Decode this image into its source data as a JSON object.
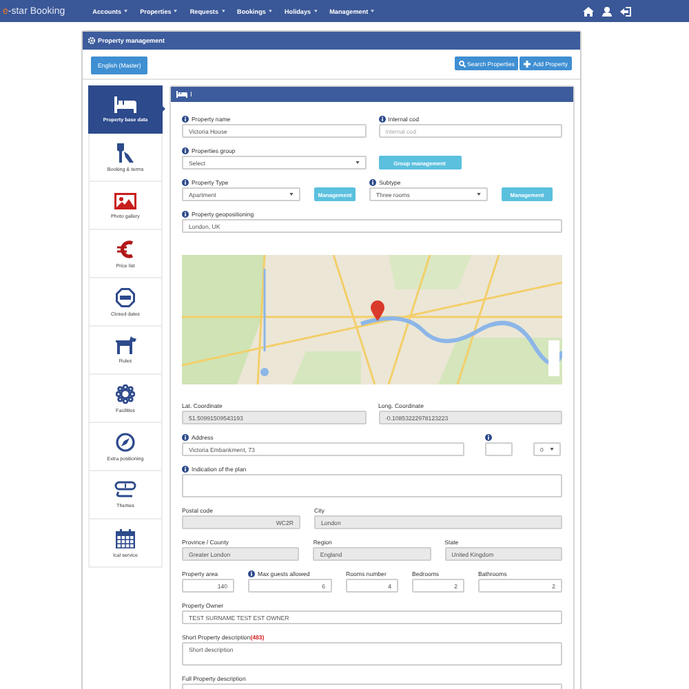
{
  "nav": {
    "brand_accent": "e",
    "brand": "-star Booking",
    "menus": [
      "Accounts",
      "Properties",
      "Requests",
      "Bookings",
      "Holidays",
      "Management"
    ]
  },
  "card_title": "Property management",
  "language_button": "English (Master)",
  "toolbar_buttons": [
    "Search Properties",
    "Add Property"
  ],
  "tabs": [
    {
      "label": "Property base data",
      "selected": true
    },
    {
      "label": "Booking & terms",
      "selected": false
    },
    {
      "label": "Photo gallery",
      "selected": false
    },
    {
      "label": "Price list",
      "selected": false
    },
    {
      "label": "Closed dates",
      "selected": false
    },
    {
      "label": "Rules",
      "selected": false
    },
    {
      "label": "Facilities",
      "selected": false
    },
    {
      "label": "Extra positioning",
      "selected": false
    },
    {
      "label": "Themes",
      "selected": false
    },
    {
      "label": "Ical service",
      "selected": false
    }
  ],
  "panel_title": "I",
  "form_rows": [
    {
      "fields": [
        {
          "kind": "input",
          "label": "Property name",
          "info": true,
          "value": "Victoria House"
        },
        {
          "kind": "input",
          "label": "Internal cod",
          "info": true,
          "placeholder": "Internal cod"
        }
      ]
    },
    {
      "fields": [
        {
          "kind": "select",
          "label": "Properties group",
          "info": true,
          "value": "Select"
        },
        {
          "kind": "button",
          "value": "Group management"
        }
      ]
    },
    {
      "fields": [
        {
          "kind": "select",
          "label": "Property Type",
          "info": true,
          "value": "Apartment"
        },
        {
          "kind": "button",
          "value": "Management"
        },
        {
          "kind": "select",
          "label": "Subtype",
          "info": true,
          "value": "Three rooms"
        },
        {
          "kind": "button",
          "value": "Management"
        }
      ]
    },
    {
      "fields": [
        {
          "kind": "input",
          "label": "Property geopositioning",
          "info": true,
          "value": "London, UK"
        }
      ]
    },
    {
      "fields": [
        {
          "kind": "map"
        }
      ]
    },
    {
      "fields": [
        {
          "kind": "input",
          "label": "Lat. Coordinate",
          "disabled": true,
          "value": "51.50991509543193"
        },
        {
          "kind": "input",
          "label": "Long. Coordinate",
          "disabled": true,
          "value": "-0.10853222978123223"
        }
      ]
    },
    {
      "fields": [
        {
          "kind": "input",
          "label": "Address",
          "info": true,
          "value": "Victoria Embankment, 73"
        },
        {
          "kind": "input",
          "info": true
        },
        {
          "kind": "select",
          "value": "0"
        }
      ]
    },
    {
      "fields": [
        {
          "kind": "textarea",
          "label": "Indication of the plan",
          "info": true
        }
      ]
    },
    {
      "fields": [
        {
          "kind": "number",
          "label": "Postal code",
          "disabled": true,
          "value": "WC2R"
        },
        {
          "kind": "input",
          "label": "City",
          "disabled": true,
          "value": "London"
        }
      ]
    },
    {
      "fields": [
        {
          "kind": "input",
          "label": "Province / County",
          "disabled": true,
          "value": "Greater London"
        },
        {
          "kind": "input",
          "label": "Region",
          "disabled": true,
          "value": "England"
        },
        {
          "kind": "input",
          "label": "State",
          "disabled": true,
          "value": "United Kingdom"
        }
      ]
    },
    {
      "fields": [
        {
          "kind": "number",
          "label": "Property area",
          "value": "140"
        },
        {
          "kind": "number",
          "label": "Max guests allowed",
          "info": true,
          "value": "6"
        },
        {
          "kind": "number",
          "label": "Rooms number",
          "value": "4"
        },
        {
          "kind": "number",
          "label": "Bedrooms",
          "value": "2"
        },
        {
          "kind": "number",
          "label": "Bathrooms",
          "value": "2"
        }
      ]
    },
    {
      "fields": [
        {
          "kind": "input",
          "label": "Property Owner",
          "value": "TEST SURNAME TEST EST OWNER"
        }
      ]
    },
    {
      "fields": [
        {
          "kind": "textarea",
          "label": "Short Property description",
          "counter": "(483)",
          "value": "Short description"
        }
      ]
    },
    {
      "fields": [
        {
          "kind": "cut",
          "label": "Full Property description"
        }
      ]
    }
  ]
}
